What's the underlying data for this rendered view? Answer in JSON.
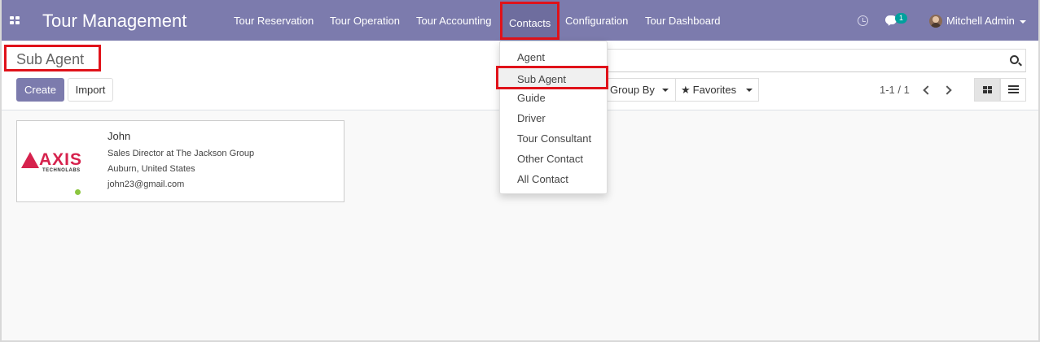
{
  "app": {
    "title": "Tour Management"
  },
  "navbar": {
    "menu": [
      {
        "label": "Tour Reservation"
      },
      {
        "label": "Tour Operation"
      },
      {
        "label": "Tour Accounting"
      },
      {
        "label": "Contacts",
        "active": true
      },
      {
        "label": "Configuration"
      },
      {
        "label": "Tour Dashboard"
      }
    ],
    "chat_badge": "1",
    "user_name": "Mitchell Admin"
  },
  "page": {
    "title": "Sub Agent"
  },
  "toolbar": {
    "create_label": "Create",
    "import_label": "Import",
    "group_by_label": "Group By",
    "favorites_label": "Favorites",
    "pager": "1-1 / 1"
  },
  "contacts_menu": {
    "items": [
      {
        "label": "Agent"
      },
      {
        "label": "Sub Agent",
        "selected": true
      },
      {
        "label": "Guide"
      },
      {
        "label": "Driver"
      },
      {
        "label": "Tour Consultant"
      },
      {
        "label": "Other Contact"
      },
      {
        "label": "All Contact"
      }
    ]
  },
  "card": {
    "name": "John",
    "job": "Sales Director at The Jackson Group",
    "location": "Auburn, United States",
    "email": "john23@gmail.com",
    "logo_text": "AXIS",
    "logo_subtext": "TECHNOLABS"
  },
  "colors": {
    "navbar": "#7c7bad",
    "highlight": "#e0121a",
    "badge": "#00a09d"
  }
}
